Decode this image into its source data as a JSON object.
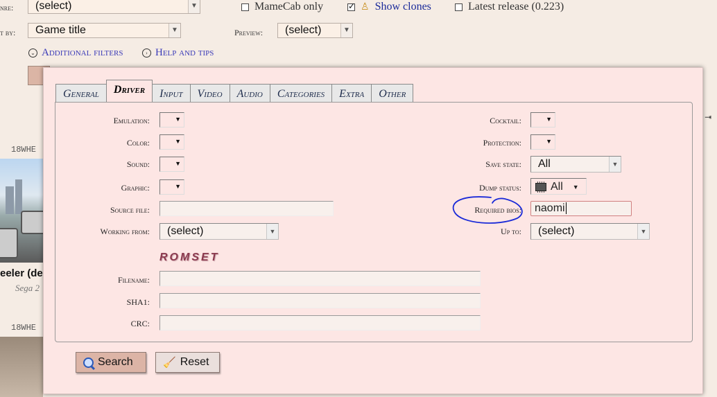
{
  "background": {
    "genre_label": "nre:",
    "genre_select": "(select)",
    "mamecab_label": "MameCab only",
    "show_clones_label": "Show clones",
    "latest_release_label": "Latest release (0.223)",
    "sort_label": "t by:",
    "sort_select": "Game title",
    "preview_label": "Preview:",
    "preview_select": "(select)",
    "additional_filters": "Additional filters",
    "help_and_tips": "Help and tips",
    "game1_name": "18WHE",
    "game1_title": "eeler (de",
    "game1_sub": "Sega 2",
    "game2_name": "18WHE"
  },
  "tabs": [
    {
      "label": "General"
    },
    {
      "label": "Driver"
    },
    {
      "label": "Input"
    },
    {
      "label": "Video"
    },
    {
      "label": "Audio"
    },
    {
      "label": "Categories"
    },
    {
      "label": "Extra"
    },
    {
      "label": "Other"
    }
  ],
  "driver": {
    "emulation_label": "Emulation:",
    "color_label": "Color:",
    "sound_label": "Sound:",
    "graphic_label": "Graphic:",
    "source_file_label": "Source file:",
    "source_file_value": "",
    "working_from_label": "Working from:",
    "working_from_value": "(select)",
    "cocktail_label": "Cocktail:",
    "protection_label": "Protection:",
    "save_state_label": "Save state:",
    "save_state_value": "All",
    "dump_status_label": "Dump status:",
    "dump_status_value": "All",
    "required_bios_label": "Required bios:",
    "required_bios_value": "naomi",
    "up_to_label": "Up to:",
    "up_to_value": "(select)",
    "romset_heading": "ROMSET",
    "filename_label": "Filename:",
    "sha1_label": "SHA1:",
    "crc_label": "CRC:"
  },
  "buttons": {
    "search": "Search",
    "reset": "Reset"
  },
  "colors": {
    "dialog_bg": "#fde6e4",
    "annotation": "#1a2ad8",
    "romset": "#8b3a4e",
    "search_btn": "#dcb4a6"
  }
}
